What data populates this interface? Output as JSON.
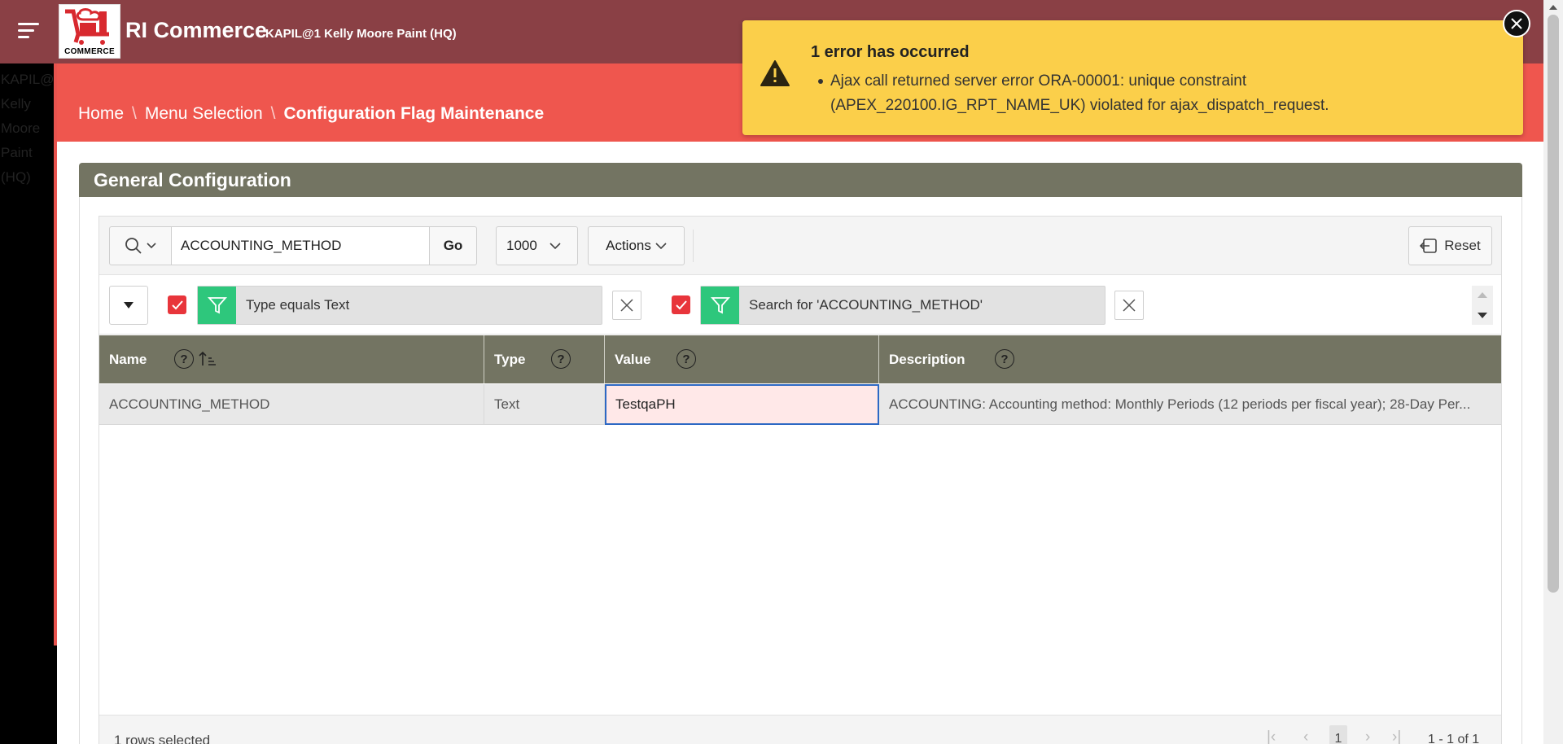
{
  "header": {
    "app_title": "RI Commerce",
    "subtitle": "KAPIL@1 Kelly Moore Paint (HQ)",
    "logo_text": "COMMERCE",
    "brand_color": "#8a4045"
  },
  "left_panel": {
    "ghost_lines": [
      "KAPIL@",
      "Kelly",
      "Moore",
      "Paint",
      "(HQ)"
    ]
  },
  "breadcrumb": {
    "items": [
      "Home",
      "Menu Selection"
    ],
    "current": "Configuration Flag Maintenance",
    "separator": "\\"
  },
  "region": {
    "title": "General Configuration"
  },
  "toolbar": {
    "search_value": "ACCOUNTING_METHOD",
    "go_label": "Go",
    "rows_per_page": "1000",
    "actions_label": "Actions",
    "reset_label": "Reset"
  },
  "filters": [
    {
      "label": "Type equals Text",
      "checked": true
    },
    {
      "label": "Search for 'ACCOUNTING_METHOD'",
      "checked": true
    }
  ],
  "table": {
    "columns": [
      {
        "label": "Name",
        "help": "?",
        "sorted": "ascending"
      },
      {
        "label": "Type",
        "help": "?"
      },
      {
        "label": "Value",
        "help": "?"
      },
      {
        "label": "Description",
        "help": "?"
      }
    ],
    "rows": [
      {
        "name": "ACCOUNTING_METHOD",
        "type": "Text",
        "value": "TestqaPH",
        "description": "ACCOUNTING: Accounting method: Monthly Periods (12 periods per fiscal year); 28-Day Per..."
      }
    ]
  },
  "footer": {
    "selected_text": "1 rows selected",
    "current_page": "1",
    "range_text": "1 - 1 of 1"
  },
  "error": {
    "title": "1 error has occurred",
    "message": "Ajax call returned server error ORA-00001: unique constraint (APEX_220100.IG_RPT_NAME_UK) violated for ajax_dispatch_request.",
    "color": "#fbcf4a"
  },
  "colors": {
    "band": "#ef564e",
    "region_header": "#737462",
    "filter_green": "#2ec77c",
    "checkbox_red": "#e8353b"
  }
}
